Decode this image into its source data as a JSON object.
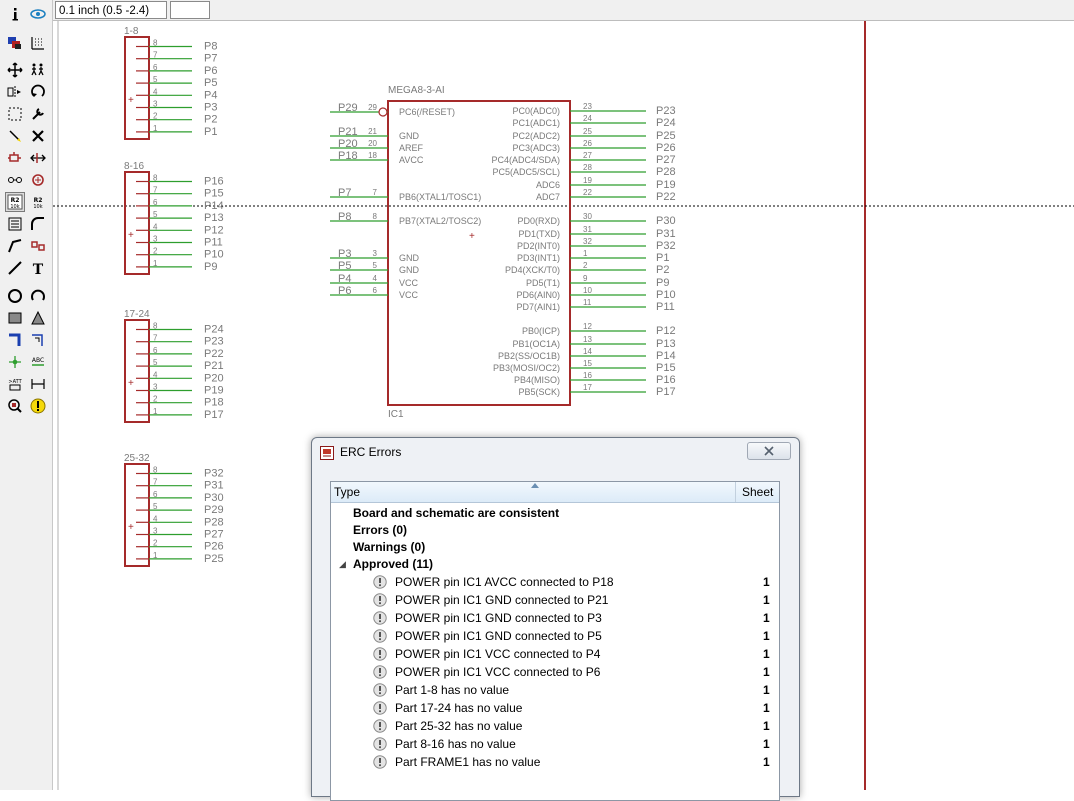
{
  "coordinate_display": "0.1 inch (0.5 -2.4)",
  "toolbar_icons": [
    "info-icon",
    "eye-icon",
    "layers-icon",
    "grid-icon",
    "move-icon",
    "copy-icon",
    "mirror-icon",
    "rotate-icon",
    "group-icon",
    "wrench-icon",
    "paste-icon",
    "delete-icon",
    "add-icon",
    "pinswap-icon",
    "replace-icon",
    "gateswap-icon",
    "name-icon",
    "value-icon",
    "smash-icon",
    "miter-icon",
    "split-icon",
    "invoke-icon",
    "wire-icon",
    "text-icon",
    "circle-icon",
    "arc-icon",
    "rect-icon",
    "polygon-icon",
    "bus-icon",
    "net-icon",
    "junction-icon",
    "label-icon",
    "attribute-icon",
    "dimension-icon",
    "erc-icon",
    "errors-icon"
  ],
  "schematic": {
    "connectors": [
      {
        "name": "1-8",
        "labels": [
          "P8",
          "P7",
          "P6",
          "P5",
          "P4",
          "P3",
          "P2",
          "P1"
        ]
      },
      {
        "name": "8-16",
        "labels": [
          "P16",
          "P15",
          "P14",
          "P13",
          "P12",
          "P11",
          "P10",
          "P9"
        ]
      },
      {
        "name": "17-24",
        "labels": [
          "P24",
          "P23",
          "P22",
          "P21",
          "P20",
          "P19",
          "P18",
          "P17"
        ]
      },
      {
        "name": "25-32",
        "labels": [
          "P32",
          "P31",
          "P30",
          "P29",
          "P28",
          "P27",
          "P26",
          "P25"
        ]
      }
    ],
    "pin_numbers": [
      "8",
      "7",
      "6",
      "5",
      "4",
      "3",
      "2",
      "1"
    ],
    "ic": {
      "name": "MEGA8-3-AI",
      "ref": "IC1",
      "left_pins": [
        {
          "net": "P29",
          "num": "29",
          "name": "PC6(/RESET)"
        },
        {
          "net": "P21",
          "num": "21",
          "name": "GND"
        },
        {
          "net": "P20",
          "num": "20",
          "name": "AREF"
        },
        {
          "net": "P18",
          "num": "18",
          "name": "AVCC"
        },
        {
          "net": "P7",
          "num": "7",
          "name": "PB6(XTAL1/TOSC1)"
        },
        {
          "net": "P8",
          "num": "8",
          "name": "PB7(XTAL2/TOSC2)"
        },
        {
          "net": "P3",
          "num": "3",
          "name": "GND"
        },
        {
          "net": "P5",
          "num": "5",
          "name": "GND"
        },
        {
          "net": "P4",
          "num": "4",
          "name": "VCC"
        },
        {
          "net": "P6",
          "num": "6",
          "name": "VCC"
        }
      ],
      "right_pins": [
        {
          "name": "PC0(ADC0)",
          "num": "23",
          "net": "P23"
        },
        {
          "name": "PC1(ADC1)",
          "num": "24",
          "net": "P24"
        },
        {
          "name": "PC2(ADC2)",
          "num": "25",
          "net": "P25"
        },
        {
          "name": "PC3(ADC3)",
          "num": "26",
          "net": "P26"
        },
        {
          "name": "PC4(ADC4/SDA)",
          "num": "27",
          "net": "P27"
        },
        {
          "name": "PC5(ADC5/SCL)",
          "num": "28",
          "net": "P28"
        },
        {
          "name": "ADC6",
          "num": "19",
          "net": "P19"
        },
        {
          "name": "ADC7",
          "num": "22",
          "net": "P22"
        },
        {
          "name": "PD0(RXD)",
          "num": "30",
          "net": "P30"
        },
        {
          "name": "PD1(TXD)",
          "num": "31",
          "net": "P31"
        },
        {
          "name": "PD2(INT0)",
          "num": "32",
          "net": "P32"
        },
        {
          "name": "PD3(INT1)",
          "num": "1",
          "net": "P1"
        },
        {
          "name": "PD4(XCK/T0)",
          "num": "2",
          "net": "P2"
        },
        {
          "name": "PD5(T1)",
          "num": "9",
          "net": "P9"
        },
        {
          "name": "PD6(AIN0)",
          "num": "10",
          "net": "P10"
        },
        {
          "name": "PD7(AIN1)",
          "num": "11",
          "net": "P11"
        },
        {
          "name": "PB0(ICP)",
          "num": "12",
          "net": "P12"
        },
        {
          "name": "PB1(OC1A)",
          "num": "13",
          "net": "P13"
        },
        {
          "name": "PB2(SS/OC1B)",
          "num": "14",
          "net": "P14"
        },
        {
          "name": "PB3(MOSI/OC2)",
          "num": "15",
          "net": "P15"
        },
        {
          "name": "PB4(MISO)",
          "num": "16",
          "net": "P16"
        },
        {
          "name": "PB5(SCK)",
          "num": "17",
          "net": "P17"
        }
      ]
    },
    "colors": {
      "symbol": "#a52a2a",
      "wire": "#2e9e2e",
      "label": "#7a7a7a",
      "frame": "#a52a2a"
    }
  },
  "dialog": {
    "title": "ERC Errors",
    "header_type": "Type",
    "header_sheet": "Sheet",
    "summary": [
      "Board and schematic are consistent",
      "Errors (0)",
      "Warnings (0)"
    ],
    "approved_label": "Approved (11)",
    "approved": [
      {
        "msg": "POWER pin IC1 AVCC connected to P18",
        "sheet": "1"
      },
      {
        "msg": "POWER pin IC1 GND connected to P21",
        "sheet": "1"
      },
      {
        "msg": "POWER pin IC1 GND connected to P3",
        "sheet": "1"
      },
      {
        "msg": "POWER pin IC1 GND connected to P5",
        "sheet": "1"
      },
      {
        "msg": "POWER pin IC1 VCC connected to P4",
        "sheet": "1"
      },
      {
        "msg": "POWER pin IC1 VCC connected to P6",
        "sheet": "1"
      },
      {
        "msg": "Part 1-8 has no value",
        "sheet": "1"
      },
      {
        "msg": "Part 17-24 has no value",
        "sheet": "1"
      },
      {
        "msg": "Part 25-32 has no value",
        "sheet": "1"
      },
      {
        "msg": "Part 8-16 has no value",
        "sheet": "1"
      },
      {
        "msg": "Part FRAME1 has no value",
        "sheet": "1"
      }
    ]
  }
}
